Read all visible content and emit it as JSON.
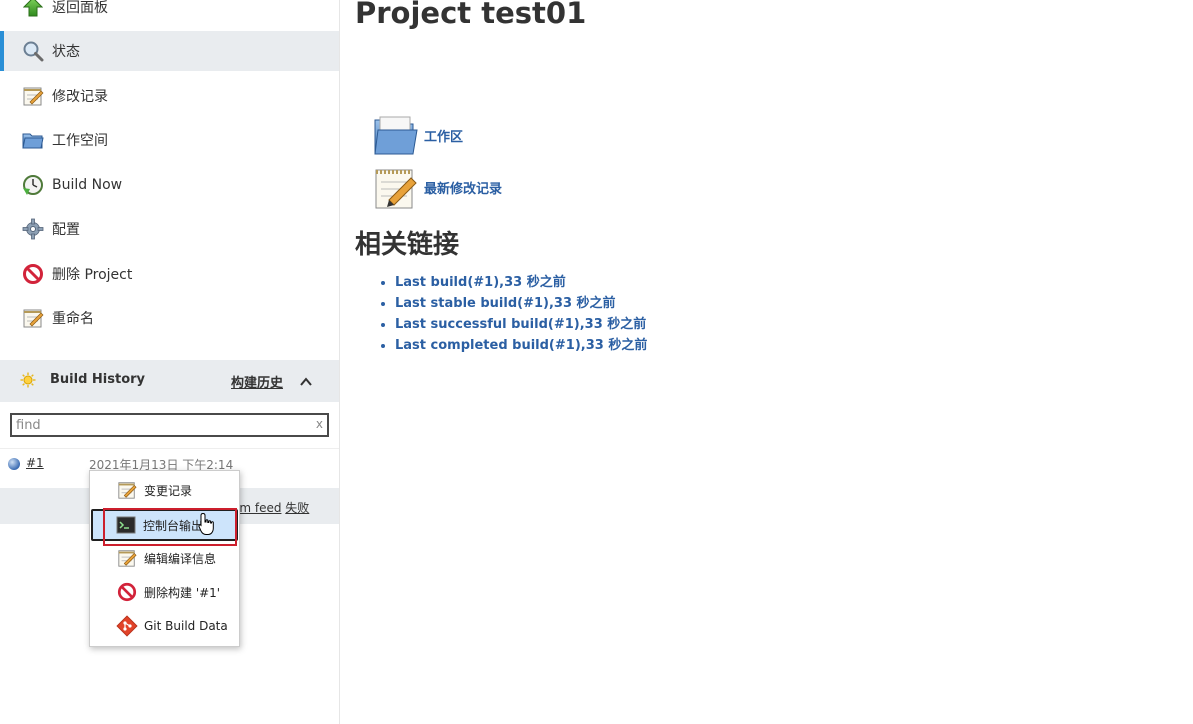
{
  "sidebar": {
    "tasks": [
      {
        "label": "返回面板",
        "icon": "up-arrow-icon"
      },
      {
        "label": "状态",
        "icon": "magnifier-icon",
        "active": true
      },
      {
        "label": "修改记录",
        "icon": "notepad-icon"
      },
      {
        "label": "工作空间",
        "icon": "folder-icon"
      },
      {
        "label": "Build Now",
        "icon": "clock-icon"
      },
      {
        "label": "配置",
        "icon": "gear-icon"
      },
      {
        "label": "删除 Project",
        "icon": "no-entry-icon"
      },
      {
        "label": "重命名",
        "icon": "notepad-icon"
      }
    ]
  },
  "build_history": {
    "title": "Build History",
    "trend_link": "构建历史",
    "search": {
      "value": "",
      "placeholder": "find",
      "clear": "x"
    },
    "builds": [
      {
        "number": "#1",
        "date": "2021年1月13日 下午2:14",
        "status_color": "#3b6cb3"
      }
    ],
    "feed": {
      "visible_text": "om feed",
      "failed_link": "失败"
    }
  },
  "context_menu": {
    "items": [
      {
        "label": "变更记录",
        "icon": "notepad-icon"
      },
      {
        "label": "控制台输出",
        "visible_label": "控制台输出",
        "icon": "terminal-icon",
        "hovered": true
      },
      {
        "label": "编辑编译信息",
        "icon": "notepad-icon"
      },
      {
        "label": "删除构建 '#1'",
        "icon": "no-entry-icon"
      },
      {
        "label": "Git Build Data",
        "icon": "git-icon"
      }
    ]
  },
  "main": {
    "title": "Project test01",
    "links": [
      {
        "label": "工作区",
        "icon": "folder-icon"
      },
      {
        "label": "最新修改记录",
        "icon": "notepad-icon"
      }
    ],
    "related_title": "相关链接",
    "permalinks": [
      "Last build(#1),33 秒之前",
      "Last stable build(#1),33 秒之前",
      "Last successful build(#1),33 秒之前",
      "Last completed build(#1),33 秒之前"
    ]
  },
  "colors": {
    "link": "#2b5fa3",
    "active_bar": "#2a8fd6",
    "highlight_box": "#cc1f2d",
    "menu_hover": "#cde4fb"
  }
}
